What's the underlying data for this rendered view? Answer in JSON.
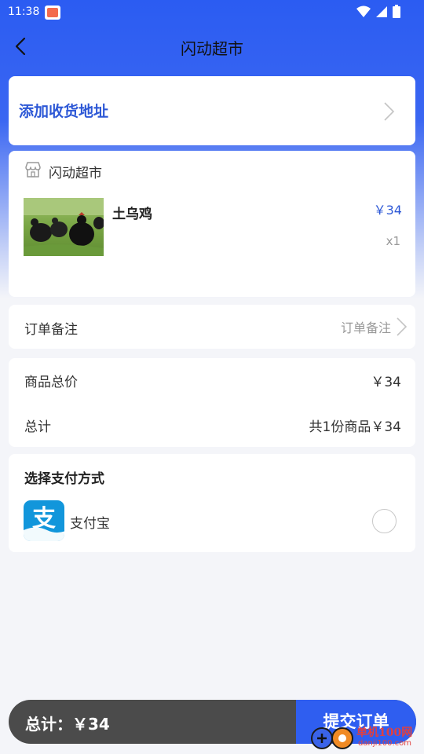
{
  "status_bar": {
    "time": "11:38"
  },
  "header": {
    "title": "闪动超市"
  },
  "address": {
    "label": "添加收货地址"
  },
  "store": {
    "name": "闪动超市",
    "product": {
      "name": "土乌鸡",
      "price": "￥34",
      "quantity": "x1"
    }
  },
  "remark": {
    "label": "订单备注",
    "placeholder": "订单备注"
  },
  "totals": {
    "goods_label": "商品总价",
    "goods_value": "￥34",
    "total_label": "总计",
    "total_value": "共1份商品￥34"
  },
  "payment": {
    "title": "选择支付方式",
    "method": {
      "name": "支付宝",
      "icon": "alipay-icon",
      "icon_glyph": "支",
      "selected": false
    }
  },
  "bottom": {
    "total_text": "总计：￥34",
    "submit_label": "提交订单"
  },
  "watermark": {
    "text": "单机100网",
    "sub": "danji100.com"
  },
  "colors": {
    "accent": "#2f5ef0",
    "link_blue": "#2d58d6",
    "alipay": "#1296db",
    "bottom_bar": "#4b4b4b"
  }
}
